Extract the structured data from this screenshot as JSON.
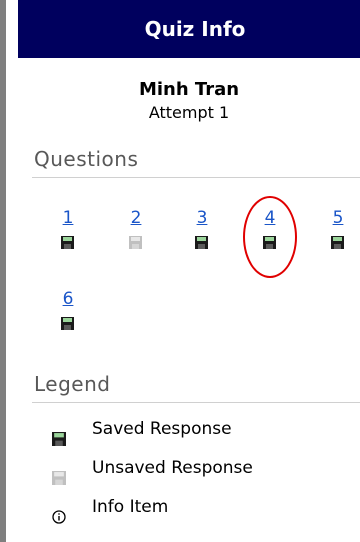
{
  "panel": {
    "title": "Quiz Info",
    "student_name": "Minh Tran",
    "attempt": "Attempt 1"
  },
  "questions": {
    "heading": "Questions",
    "items": [
      {
        "number": "1",
        "status": "saved"
      },
      {
        "number": "2",
        "status": "unsaved"
      },
      {
        "number": "3",
        "status": "saved"
      },
      {
        "number": "4",
        "status": "saved"
      },
      {
        "number": "5",
        "status": "saved"
      },
      {
        "number": "6",
        "status": "saved"
      }
    ]
  },
  "legend": {
    "heading": "Legend",
    "items": [
      {
        "label": "Saved Response",
        "icon": "saved-floppy-icon"
      },
      {
        "label": "Unsaved Response",
        "icon": "unsaved-floppy-icon"
      },
      {
        "label": "Info Item",
        "icon": "info-icon"
      }
    ]
  },
  "colors": {
    "header_bg": "#00005e",
    "link": "#1a55c8",
    "saved_icon": "#1a1a1a",
    "unsaved_icon": "#c0c0c0",
    "highlight_circle": "#e00000"
  }
}
